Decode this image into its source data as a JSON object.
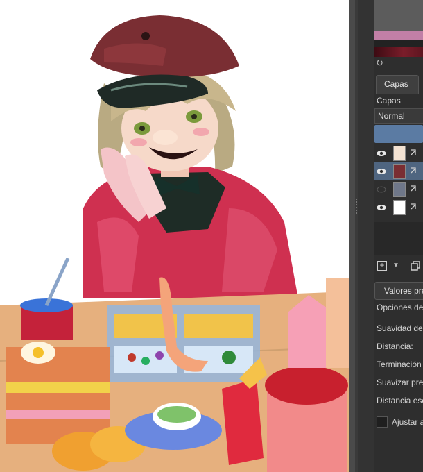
{
  "panel": {
    "tab_label": "Capas",
    "section_label": "Capas",
    "blend_mode": "Normal",
    "layers": [
      {
        "visible": true,
        "selected": false,
        "thumb": "food"
      },
      {
        "visible": true,
        "selected": true,
        "thumb": "character"
      },
      {
        "visible": false,
        "selected": false,
        "thumb": "gray"
      },
      {
        "visible": true,
        "selected": false,
        "thumb": "white"
      }
    ],
    "presets_label": "Valores pre",
    "properties": [
      "Opciones de",
      "Suavidad del",
      "Distancia:",
      "Terminación",
      "Suavizar pres",
      "Distancia esc"
    ],
    "adjust_label": "Ajustar a"
  },
  "colors": {
    "accent_pink": "#c27fa6",
    "selection_blue": "#5b7ba3",
    "panel_bg": "#2e2e2e"
  },
  "icons": [
    "eye-icon",
    "link-icon",
    "add-layer-icon",
    "duplicate-layer-icon",
    "refresh-icon"
  ]
}
